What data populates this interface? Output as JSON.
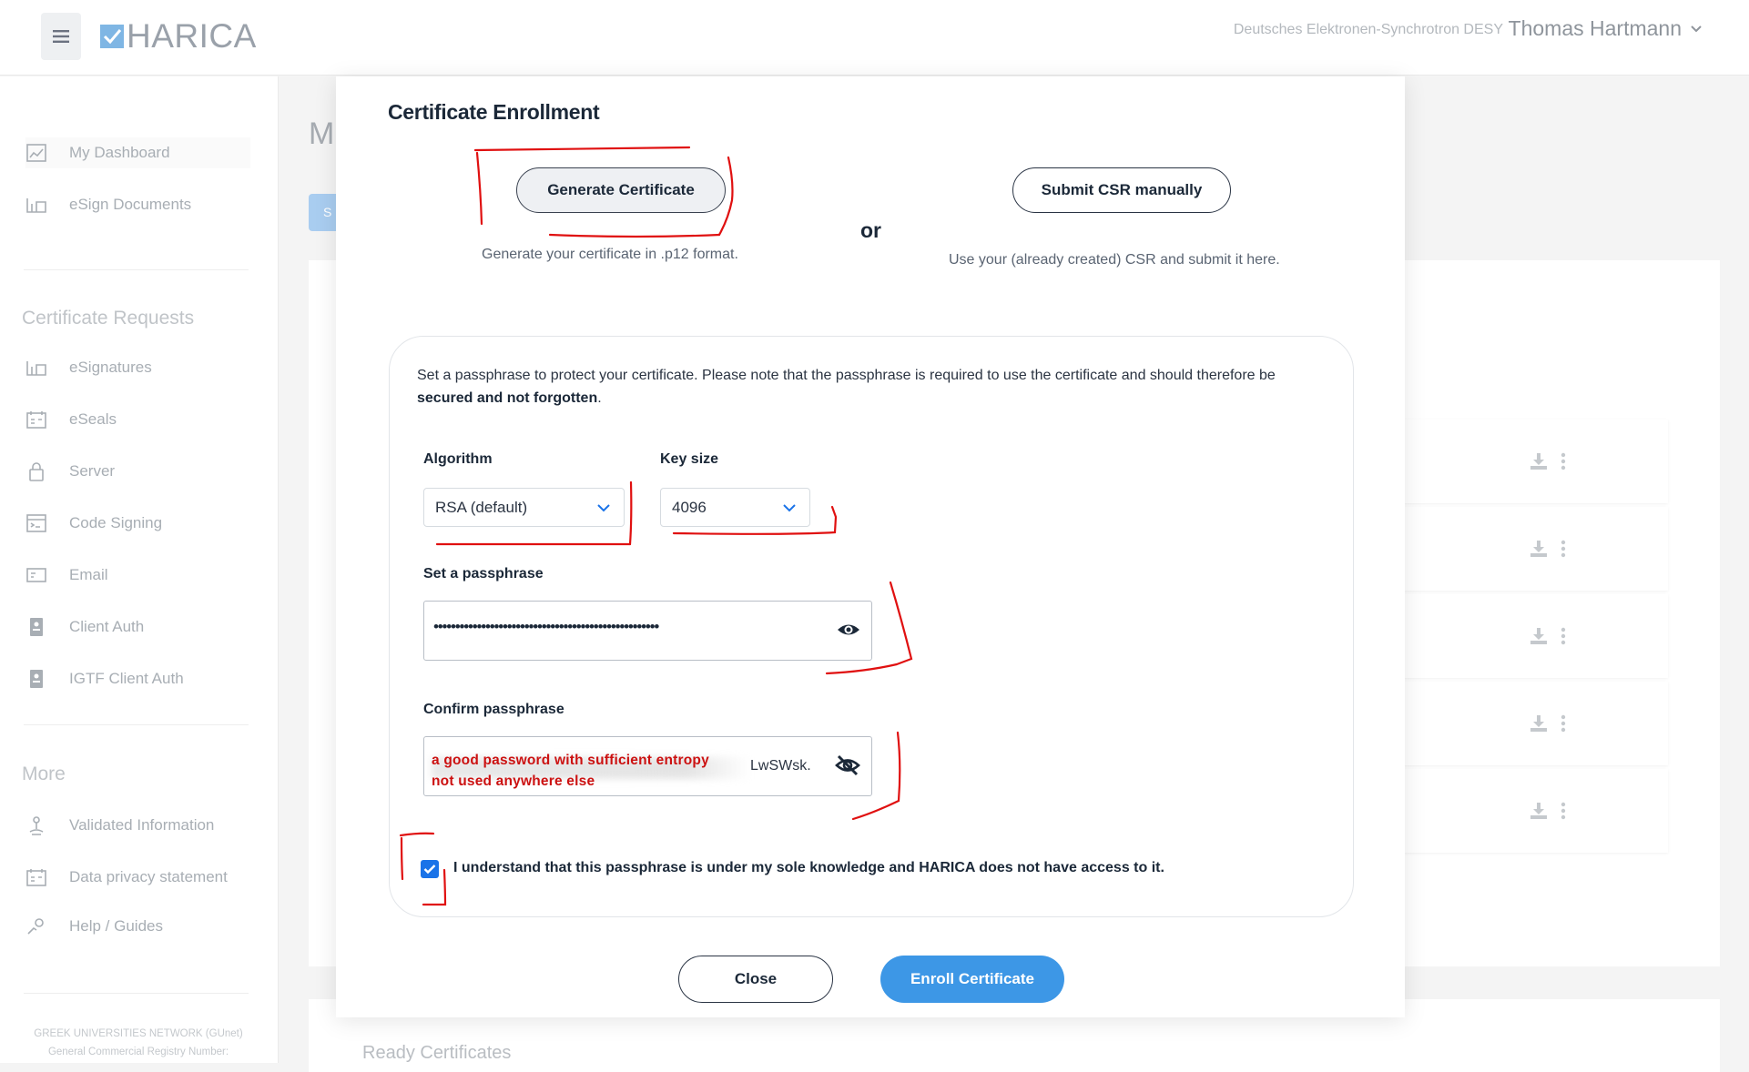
{
  "header": {
    "logo_text": "HARICA",
    "organization": "Deutsches Elektronen-Synchrotron DESY",
    "user_name": "Thomas Hartmann"
  },
  "sidebar": {
    "items_top": [
      {
        "label": "My Dashboard",
        "icon": "dashboard-icon"
      },
      {
        "label": "eSign Documents",
        "icon": "esign-icon"
      }
    ],
    "section_requests": "Certificate Requests",
    "items_requests": [
      {
        "label": "eSignatures",
        "icon": "esign-icon"
      },
      {
        "label": "eSeals",
        "icon": "seal-icon"
      },
      {
        "label": "Server",
        "icon": "lock-icon"
      },
      {
        "label": "Code Signing",
        "icon": "code-icon"
      },
      {
        "label": "Email",
        "icon": "email-icon"
      },
      {
        "label": "Client Auth",
        "icon": "badge-icon"
      },
      {
        "label": "IGTF Client Auth",
        "icon": "badge-icon"
      }
    ],
    "section_more": "More",
    "items_more": [
      {
        "label": "Validated Information",
        "icon": "validated-icon"
      },
      {
        "label": "Data privacy statement",
        "icon": "privacy-icon"
      },
      {
        "label": "Help / Guides",
        "icon": "help-icon"
      }
    ],
    "footer_line1": "GREEK UNIVERSITIES NETWORK (GUnet)",
    "footer_line2": "General Commercial Registry Number:"
  },
  "background": {
    "page_title_partial": "M",
    "button_partial": "S",
    "ready_title": "Ready Certificates"
  },
  "modal": {
    "title": "Certificate Enrollment",
    "generate_label": "Generate Certificate",
    "generate_hint": "Generate your certificate in .p12 format.",
    "or_label": "or",
    "csr_label": "Submit CSR manually",
    "csr_hint": "Use your (already created) CSR and submit it here.",
    "info_text_1": "Set a passphrase to protect your certificate. Please note that the passphrase is required to use the certificate and should therefore be ",
    "info_text_bold": "secured and not forgotten",
    "info_text_2": ".",
    "algorithm_label": "Algorithm",
    "algorithm_value": "RSA (default)",
    "keysize_label": "Key size",
    "keysize_value": "4096",
    "passphrase_label": "Set a passphrase",
    "passphrase_masked": "••••••••••••••••••••••••••••••••••••••••••••••••••••",
    "confirm_label": "Confirm passphrase",
    "confirm_tail": "LwSWsk.",
    "annotation_line1": "a good password with sufficient entropy",
    "annotation_line2": "not used anywhere else",
    "checkbox_label": "I understand that this passphrase is under my sole knowledge and HARICA does not have access to it.",
    "checkbox_checked": true,
    "close_label": "Close",
    "enroll_label": "Enroll Certificate"
  },
  "colors": {
    "accent": "#3d97e6",
    "annotation_red": "#e01010",
    "checkbox_blue": "#1a73e8"
  }
}
